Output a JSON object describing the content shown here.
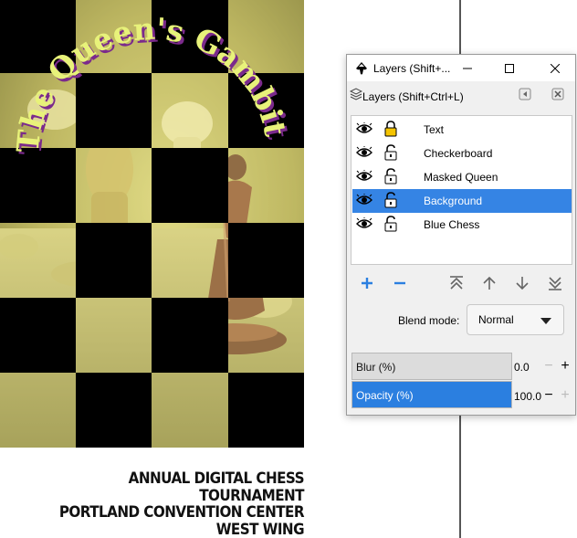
{
  "poster": {
    "curved_title": "The Queen's Gambit",
    "lines": [
      "ANNUAL DIGITAL CHESS TOURNAMENT",
      "PORTLAND CONVENTION CENTER",
      "WEST WING"
    ]
  },
  "dialog": {
    "window_title": "Layers (Shift+...",
    "panel_title": "Layers (Shift+Ctrl+L)",
    "layers": [
      {
        "name": "Text",
        "visible": true,
        "locked": true,
        "selected": false
      },
      {
        "name": "Checkerboard",
        "visible": true,
        "locked": false,
        "selected": false
      },
      {
        "name": "Masked Queen",
        "visible": true,
        "locked": false,
        "selected": false
      },
      {
        "name": "Background",
        "visible": true,
        "locked": false,
        "selected": true
      },
      {
        "name": "Blue Chess",
        "visible": true,
        "locked": false,
        "selected": false
      }
    ],
    "toolbar": {
      "add_icon": "plus-icon",
      "remove_icon": "minus-icon",
      "raise_top_icon": "raise-to-top-icon",
      "raise_icon": "raise-icon",
      "lower_icon": "lower-icon",
      "lower_bottom_icon": "lower-to-bottom-icon"
    },
    "blend_label": "Blend mode:",
    "blend_value": "Normal",
    "blur": {
      "label": "Blur (%)",
      "value": "0.0",
      "fraction": 0.0
    },
    "opacity": {
      "label": "Opacity (%)",
      "value": "100.0",
      "fraction": 1.0
    }
  },
  "colors": {
    "selection": "#3584e4",
    "accent_blue": "#2b7fe0",
    "title_text": "#e8f27a",
    "title_shadow": "#7b2a8c"
  }
}
